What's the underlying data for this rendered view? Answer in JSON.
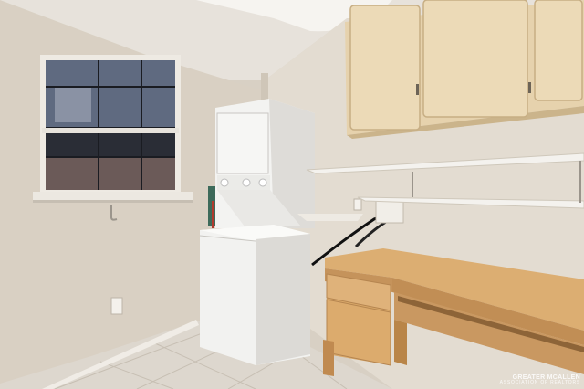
{
  "scene": {
    "description_colors": {
      "left_wall": "#d9d0c3",
      "right_wall": "#e2dbd0",
      "ceiling": "#e6e1da",
      "cabinet_wood": "#e6d2ad",
      "desk_wood": "#d9aa6d",
      "appliance": "#f4f4f2",
      "floor_tile": "#ddd8d0",
      "window_glass": "#2a2d36"
    }
  },
  "watermark": {
    "line1": "GREATER MCALLEN",
    "line2": "ASSOCIATION OF REALTORS"
  }
}
